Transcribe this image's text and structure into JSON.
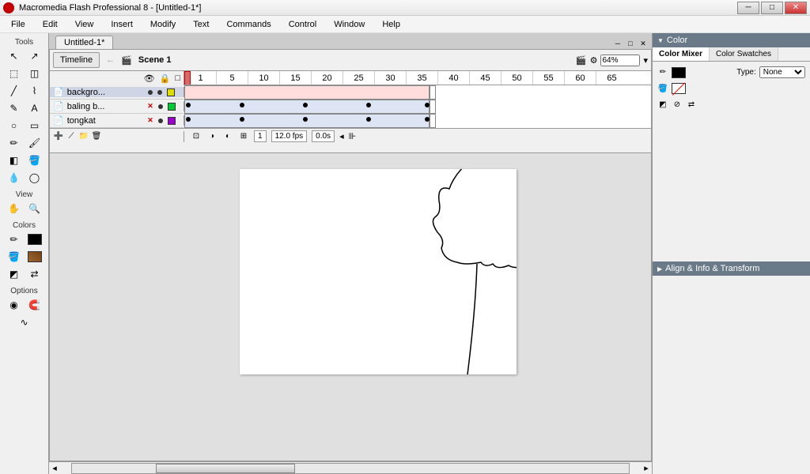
{
  "titlebar": {
    "title": "Macromedia Flash Professional 8 - [Untitled-1*]"
  },
  "menu": [
    "File",
    "Edit",
    "View",
    "Insert",
    "Modify",
    "Text",
    "Commands",
    "Control",
    "Window",
    "Help"
  ],
  "tools": {
    "label": "Tools",
    "view": "View",
    "colors": "Colors",
    "options": "Options"
  },
  "document": {
    "tab": "Untitled-1*",
    "scene": "Scene 1",
    "timeline_btn": "Timeline"
  },
  "zoom": {
    "value": "64%"
  },
  "ruler_marks": [
    "1",
    "5",
    "10",
    "15",
    "20",
    "25",
    "30",
    "35",
    "40",
    "45",
    "50",
    "55",
    "60",
    "65"
  ],
  "layers": [
    {
      "name": "backgro...",
      "color": "#dddd00",
      "selected": true,
      "vis": "dot",
      "lock": "dot"
    },
    {
      "name": "baling b...",
      "color": "#00cc33",
      "selected": false,
      "vis": "x",
      "lock": "dot"
    },
    {
      "name": "tongkat",
      "color": "#9900cc",
      "selected": false,
      "vis": "x",
      "lock": "dot"
    }
  ],
  "timeline_status": {
    "frame": "1",
    "fps": "12.0 fps",
    "time": "0.0s"
  },
  "color_panel": {
    "title": "Color",
    "tab_mixer": "Color Mixer",
    "tab_swatches": "Color Swatches",
    "type_label": "Type:",
    "type_value": "None"
  },
  "transform_panel": {
    "title": "Align & Info & Transform"
  }
}
